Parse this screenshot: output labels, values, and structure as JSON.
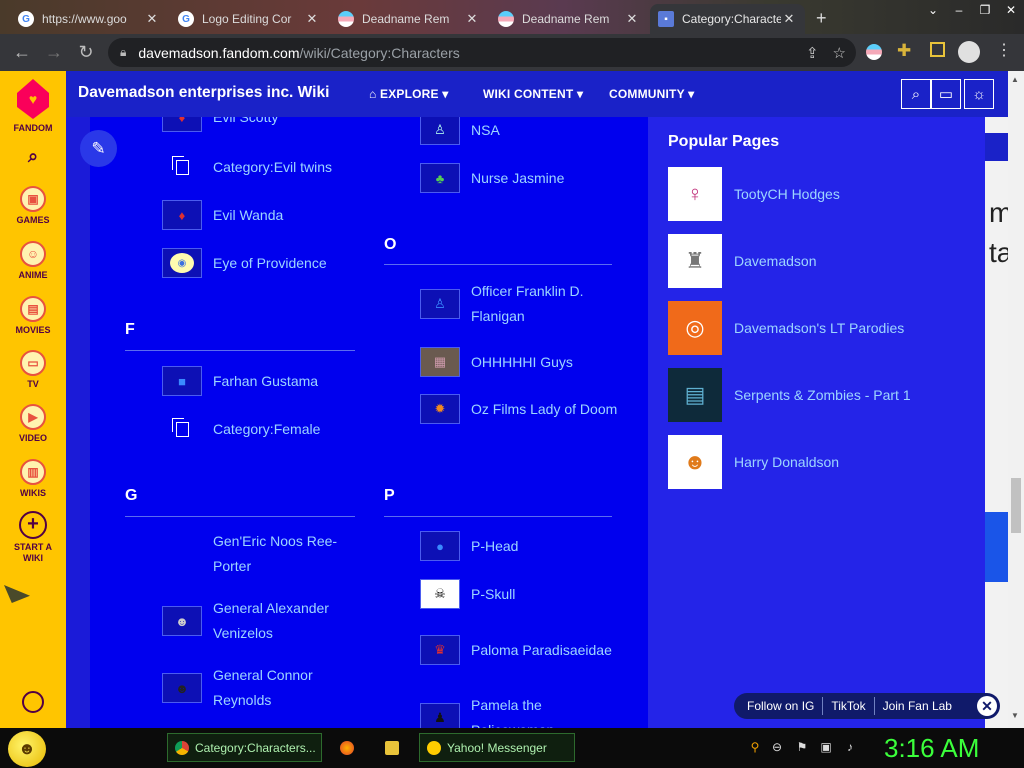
{
  "browser": {
    "tabs": [
      {
        "label": "https://www.goo",
        "icon": "google-g-icon",
        "active": false
      },
      {
        "label": "Logo Editing Cor",
        "icon": "google-g-icon",
        "active": false
      },
      {
        "label": "Deadname Rem",
        "icon": "pride-flag-icon",
        "active": false
      },
      {
        "label": "Deadname Rem",
        "icon": "pride-flag-icon",
        "active": false
      },
      {
        "label": "Category:Characte",
        "icon": "fandom-wiki-icon",
        "active": true
      }
    ],
    "new_tab_symbol": "+",
    "url_host": "davemadson.fandom.com",
    "url_path": "/wiki/Category:Characters"
  },
  "rail": {
    "items": [
      {
        "label": "FANDOM",
        "icon": "fandom-logo-icon"
      },
      {
        "label": "",
        "icon": "search-icon"
      },
      {
        "label": "GAMES",
        "icon": "gamepad-icon"
      },
      {
        "label": "ANIME",
        "icon": "anime-face-icon"
      },
      {
        "label": "MOVIES",
        "icon": "clapperboard-icon"
      },
      {
        "label": "TV",
        "icon": "tv-icon"
      },
      {
        "label": "VIDEO",
        "icon": "play-icon"
      },
      {
        "label": "WIKIS",
        "icon": "book-icon"
      },
      {
        "label": "START A WIKI",
        "icon": "plus-circle-icon"
      }
    ]
  },
  "wiki": {
    "title": "Davemadson enterprises inc. Wiki",
    "nav": [
      {
        "label": "EXPLORE",
        "icon": "explore-icon"
      },
      {
        "label": "WIKI CONTENT"
      },
      {
        "label": "COMMUNITY"
      }
    ]
  },
  "content": {
    "col1": [
      {
        "type": "entry",
        "label": "Evil Scotty",
        "thumb": "character"
      },
      {
        "type": "entry",
        "label": "Category:Evil twins",
        "thumb": "category"
      },
      {
        "type": "entry",
        "label": "Evil Wanda",
        "thumb": "character"
      },
      {
        "type": "entry",
        "label": "Eye of Providence",
        "thumb": "eye"
      },
      {
        "type": "section",
        "label": "F"
      },
      {
        "type": "entry",
        "label": "Farhan Gustama",
        "thumb": "character"
      },
      {
        "type": "entry",
        "label": "Category:Female",
        "thumb": "category"
      },
      {
        "type": "section",
        "label": "G"
      },
      {
        "type": "entry",
        "label": "Gen'Eric Noos Ree-Porter",
        "thumb": "none"
      },
      {
        "type": "entry",
        "label": "General Alexander Venizelos",
        "thumb": "character"
      },
      {
        "type": "entry",
        "label": "General Connor Reynolds",
        "thumb": "character"
      }
    ],
    "col2": [
      {
        "type": "entry",
        "label": "NSA",
        "thumb": "character"
      },
      {
        "type": "entry",
        "label": "Nurse Jasmine",
        "thumb": "character"
      },
      {
        "type": "section",
        "label": "O"
      },
      {
        "type": "entry",
        "label": "Officer Franklin D. Flanigan",
        "thumb": "character"
      },
      {
        "type": "entry",
        "label": "OHHHHHI Guys",
        "thumb": "photo"
      },
      {
        "type": "entry",
        "label": "Oz Films Lady of Doom",
        "thumb": "character"
      },
      {
        "type": "section",
        "label": "P"
      },
      {
        "type": "entry",
        "label": "P-Head",
        "thumb": "character"
      },
      {
        "type": "entry",
        "label": "P-Skull",
        "thumb": "skull"
      },
      {
        "type": "entry",
        "label": "Paloma Paradisaeidae",
        "thumb": "character"
      },
      {
        "type": "entry",
        "label": "Pamela the Policewoman",
        "thumb": "character"
      }
    ]
  },
  "popular": {
    "title": "Popular Pages",
    "items": [
      {
        "label": "TootyCH Hodges"
      },
      {
        "label": "Davemadson"
      },
      {
        "label": "Davemadson's LT Parodies"
      },
      {
        "label": "Serpents & Zombies - Part 1"
      },
      {
        "label": "Harry Donaldson"
      }
    ]
  },
  "followbar": {
    "items": [
      "Follow on IG",
      "TikTok",
      "Join Fan Lab"
    ]
  },
  "taskbar": {
    "apps": [
      {
        "label": "Category:Characters...",
        "icon": "chrome-icon"
      },
      {
        "label": "",
        "icon": "firefox-icon"
      },
      {
        "label": "",
        "icon": "folder-icon"
      },
      {
        "label": "Yahoo! Messenger",
        "icon": "yahoo-smiley-icon"
      }
    ],
    "clock": "3:16 AM"
  }
}
